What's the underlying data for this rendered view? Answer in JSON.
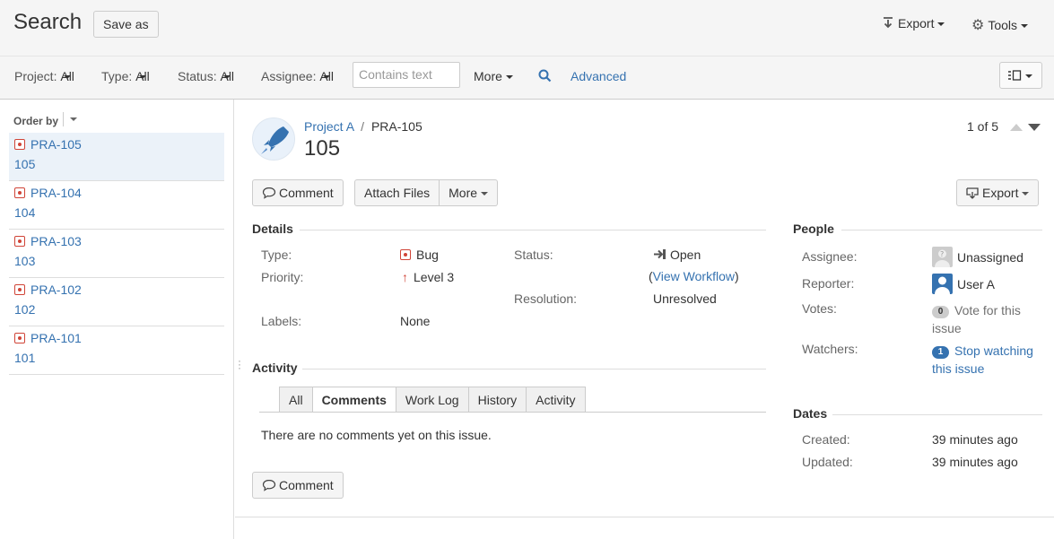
{
  "header": {
    "title": "Search",
    "save_as": "Save as",
    "export": "Export",
    "tools": "Tools"
  },
  "filters": {
    "project_label": "Project:",
    "project_val": "All",
    "type_label": "Type:",
    "type_val": "All",
    "status_label": "Status:",
    "status_val": "All",
    "assignee_label": "Assignee:",
    "assignee_val": "All",
    "text_placeholder": "Contains text",
    "more": "More",
    "advanced": "Advanced"
  },
  "list": {
    "order_by": "Order by",
    "items": [
      {
        "key": "PRA-105",
        "summary": "105"
      },
      {
        "key": "PRA-104",
        "summary": "104"
      },
      {
        "key": "PRA-103",
        "summary": "103"
      },
      {
        "key": "PRA-102",
        "summary": "102"
      },
      {
        "key": "PRA-101",
        "summary": "101"
      }
    ]
  },
  "issue": {
    "project": "Project A",
    "separator": "/",
    "key": "PRA-105",
    "title": "105",
    "pager": "1 of 5",
    "buttons": {
      "comment": "Comment",
      "attach": "Attach Files",
      "more": "More",
      "export": "Export"
    },
    "details": {
      "heading": "Details",
      "type_label": "Type:",
      "type_val": "Bug",
      "priority_label": "Priority:",
      "priority_val": "Level 3",
      "labels_label": "Labels:",
      "labels_val": "None",
      "status_label": "Status:",
      "status_val": "Open",
      "workflow_open": "(",
      "workflow_link": "View Workflow",
      "workflow_close": ")",
      "resolution_label": "Resolution:",
      "resolution_val": "Unresolved"
    },
    "activity": {
      "heading": "Activity",
      "tabs": [
        "All",
        "Comments",
        "Work Log",
        "History",
        "Activity"
      ],
      "active_tab": "Comments",
      "empty_text": "There are no comments yet on this issue.",
      "comment_button": "Comment"
    },
    "people": {
      "heading": "People",
      "assignee_label": "Assignee:",
      "assignee_val": "Unassigned",
      "reporter_label": "Reporter:",
      "reporter_val": "User A",
      "votes_label": "Votes:",
      "votes_count": "0",
      "votes_link": "Vote for this",
      "votes_link2": "issue",
      "watchers_label": "Watchers:",
      "watchers_count": "1",
      "watchers_link": "Stop watching",
      "watchers_link2": "this issue"
    },
    "dates": {
      "heading": "Dates",
      "created_label": "Created:",
      "created_val": "39 minutes ago",
      "updated_label": "Updated:",
      "updated_val": "39 minutes ago"
    }
  },
  "colors": {
    "link": "#3572b0",
    "bug": "#d04437",
    "header_bg": "#f5f5f5",
    "selected_bg": "#ebf2f9"
  }
}
